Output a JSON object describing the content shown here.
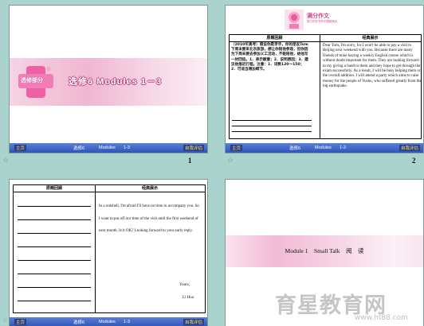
{
  "slides": [
    {
      "label": "选修部分",
      "title": "选修6   Modules 1－3",
      "footer": {
        "left": "主页",
        "mid1": "选修6",
        "mid2": "Modules",
        "mid3": "1-3",
        "right": "自我评估"
      },
      "page_number": "1"
    },
    {
      "logo_title": "满分作文",
      "logo_sub": "助力你在写作中脱颖而出",
      "left_header": "原题回顾",
      "right_header": "经典展示",
      "left_text": "（2010年高考）假设你是李华，你的朋友Tom下周末要来北京旅游，想让你陪他参观，但你因为下周末要去参加义工活动，不能陪他，给他写一封回信。1．表示歉意；2．说明原因；3．建议他推迟行程。注意：1．词数120～150；2．可适当增加细节。",
      "right_text": "Dear Tom, I'm sorry, for I won't be able to pay a visit to Beijing next weekend with you. Because there are many friends of mine having a weekly English course which is without doubt important for them. They are looking forward to my giving a hand to them and they hope to get through the exam successfully. As a result, I will be busy helping them or the overall addition. I will attend a party which aims to raise money for the people of Yushu, who suffered greatly from the big earthquake.",
      "footer": {
        "left": "主页",
        "mid1": "选修6",
        "mid2": "Modules",
        "mid3": "1-3",
        "right": "自我评估"
      },
      "page_number": "2"
    },
    {
      "left_header": "原题回顾",
      "right_header": "经典展示",
      "right_text": "In a nutshell, I'm afraid I'll have no time to accompany you. So I want to put off our time of the visit until the first weekend of next month. Is it OK? Looking forward to your early reply.",
      "sign_off": "Yours,",
      "signature": "Li Hua",
      "footer": {
        "left": "主页",
        "mid1": "选修6",
        "mid2": "Modules",
        "mid3": "1-3",
        "right": "自我评估"
      }
    },
    {
      "title": "Module 1　Small Talk　阅　读"
    }
  ],
  "watermark": "育星教育网",
  "watermark_url": "www.ht88.com",
  "colors": {
    "background": "#a9d3cc",
    "footer_blue": "#2f55b8",
    "brand_pink": "#d83e88"
  }
}
